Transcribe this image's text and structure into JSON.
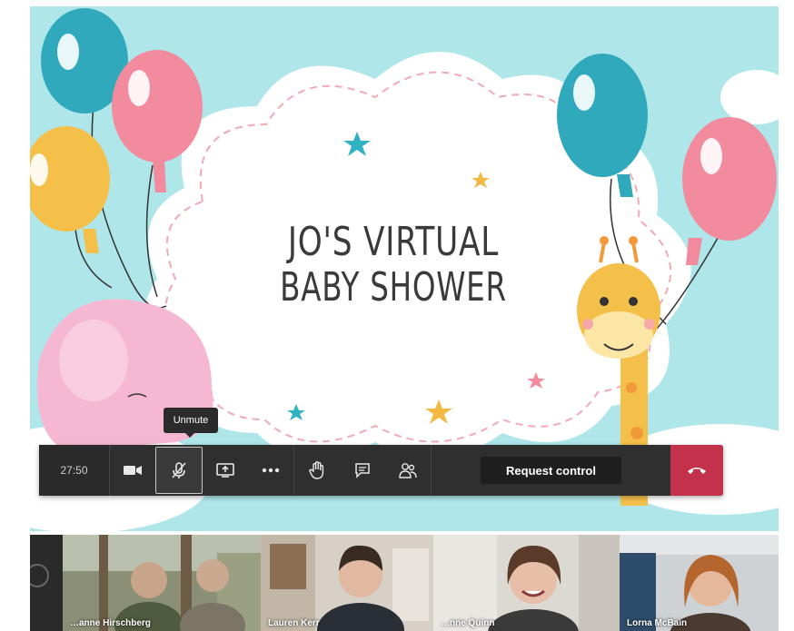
{
  "slide": {
    "title_line1": "JO'S VIRTUAL",
    "title_line2": "BABY SHOWER"
  },
  "tooltip": {
    "text": "Unmute"
  },
  "toolbar": {
    "timer": "27:50",
    "camera_icon": "video-camera-icon",
    "mic_icon": "microphone-off-icon",
    "share_icon": "share-screen-icon",
    "more_icon": "more-options-icon",
    "hand_icon": "raise-hand-icon",
    "chat_icon": "chat-icon",
    "participants_icon": "participants-icon",
    "request_control_label": "Request control",
    "hangup_icon": "hang-up-icon",
    "hangup_color": "#c4314b"
  },
  "participants": [
    {
      "name": ""
    },
    {
      "name": "…anne Hirschberg"
    },
    {
      "name": "Lauren Kerr"
    },
    {
      "name": "…nne Quinn"
    },
    {
      "name": "Lorna McBain"
    }
  ]
}
